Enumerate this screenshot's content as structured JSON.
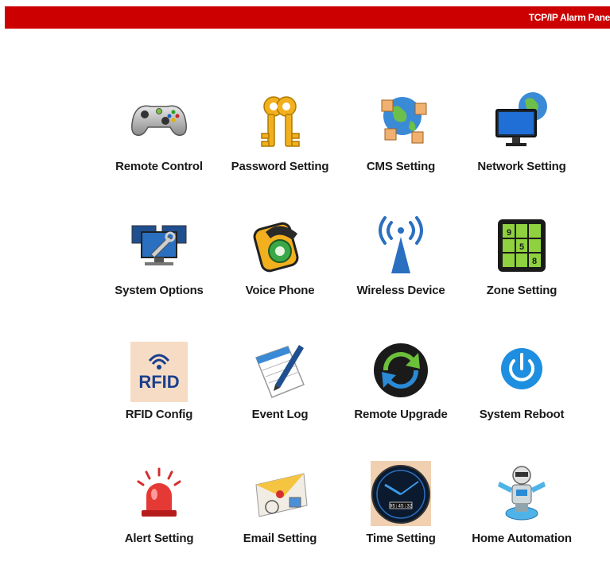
{
  "header": {
    "title": "TCP/IP Alarm Pane",
    "accent_color": "#cc0000"
  },
  "menu": {
    "items": [
      {
        "label": "Remote Control",
        "icon": "gamepad-icon"
      },
      {
        "label": "Password Setting",
        "icon": "keys-icon"
      },
      {
        "label": "CMS Setting",
        "icon": "globe-network-icon"
      },
      {
        "label": "Network Setting",
        "icon": "monitor-globe-icon"
      },
      {
        "label": "System Options",
        "icon": "computers-tools-icon"
      },
      {
        "label": "Voice Phone",
        "icon": "phone-icon"
      },
      {
        "label": "Wireless Device",
        "icon": "antenna-icon"
      },
      {
        "label": "Zone Setting",
        "icon": "zone-grid-icon"
      },
      {
        "label": "RFID Config",
        "icon": "rfid-icon"
      },
      {
        "label": "Event Log",
        "icon": "notepad-pen-icon"
      },
      {
        "label": "Remote Upgrade",
        "icon": "sync-arrows-icon"
      },
      {
        "label": "System Reboot",
        "icon": "power-icon"
      },
      {
        "label": "Alert Setting",
        "icon": "siren-icon"
      },
      {
        "label": "Email Setting",
        "icon": "envelope-icon"
      },
      {
        "label": "Time Setting",
        "icon": "clock-icon"
      },
      {
        "label": "Home Automation",
        "icon": "robot-icon"
      }
    ],
    "zone_digits": [
      "9",
      "5",
      "8"
    ],
    "rfid_text": "RFID",
    "clock_readout": "05:45:32"
  }
}
